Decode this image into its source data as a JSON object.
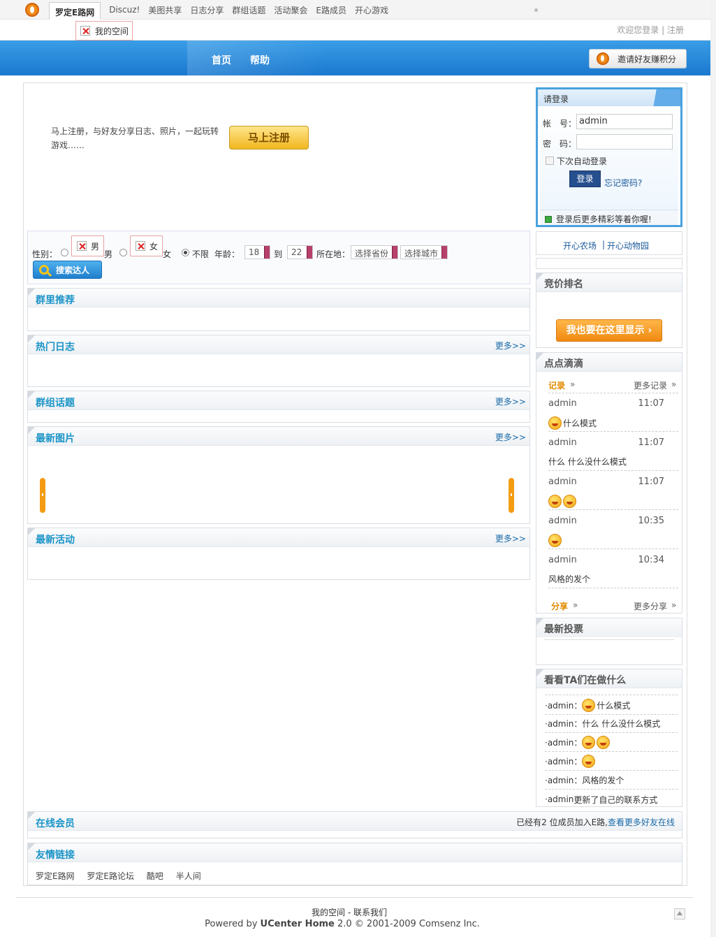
{
  "topbar": {
    "nav": [
      "罗定E路网",
      "Discuz!",
      "美图共享",
      "日志分享",
      "群组话题",
      "活动聚会",
      "E路成员",
      "开心游戏"
    ],
    "my_space": "我的空间",
    "welcome": "欢迎您登录",
    "register_link": "| 注册"
  },
  "header": {
    "home": "首页",
    "help": "帮助",
    "invite": "邀请好友赚积分"
  },
  "intro": {
    "text": "马上注册，与好友分享日志、照片，一起玩转游戏……",
    "register_button": "马上注册"
  },
  "search": {
    "gender_label": "性别：",
    "male_img": "男",
    "male": "男",
    "female_img": "女",
    "female": "女",
    "unlimited": "不限",
    "age_label": "年龄：",
    "age_from": "18",
    "to": "到",
    "age_to": "22",
    "location_label": "所在地：",
    "province": "选择省份",
    "city": "选择城市",
    "button": "搜索达人"
  },
  "panels": {
    "groups": "群里推荐",
    "blogs": "热门日志",
    "topics": "群组话题",
    "photos": "最新图片",
    "events": "最新活动",
    "more": "更多>>"
  },
  "login": {
    "title": "请登录",
    "account_label": "帐　号：",
    "account_value": "admin",
    "password_label": "密　码：",
    "remember": "下次自动登录",
    "button": "登录",
    "forgot": "忘记密码?",
    "footer": "登录后更多精彩等着你喔!"
  },
  "farm": {
    "farm": "开心农场",
    "sep": "|",
    "zoo": "开心动物园"
  },
  "bidding": {
    "title": "竞价排名",
    "button": "我也要在这里显示 ›"
  },
  "doings": {
    "title": "点点滴滴",
    "record_tab": "记录",
    "more_record": "更多记录",
    "share_tab": "分享",
    "more_share": "更多分享",
    "arrow": "»",
    "items": [
      {
        "user": "admin",
        "time": "11:07",
        "msg": "什么模式",
        "smiles": 1
      },
      {
        "user": "admin",
        "time": "11:07",
        "msg": "什么  什么没什么模式",
        "smiles": 0
      },
      {
        "user": "admin",
        "time": "11:07",
        "msg": "",
        "smiles": 2
      },
      {
        "user": "admin",
        "time": "10:35",
        "msg": "",
        "smiles": 1
      },
      {
        "user": "admin",
        "time": "10:34",
        "msg": "风格的发个",
        "smiles": 0
      }
    ]
  },
  "polls": {
    "title": "最新投票"
  },
  "whatdo": {
    "title": "看看TA们在做什么",
    "items": [
      {
        "text": "·admin：",
        "rest": "什么模式",
        "smiles": 1
      },
      {
        "text": "·admin：",
        "rest": "什么  什么没什么模式",
        "smiles": 0
      },
      {
        "text": "·admin：",
        "rest": "",
        "smiles": 2
      },
      {
        "text": "·admin：",
        "rest": "",
        "smiles": 1
      },
      {
        "text": "·admin：",
        "rest": "风格的发个",
        "smiles": 0
      },
      {
        "text": "·admin",
        "rest": " 更新了自己的联系方式",
        "smiles": 0
      }
    ]
  },
  "online": {
    "title": "在线会员",
    "text": "已经有2 位成员加入E路,",
    "link": "查看更多好友在线"
  },
  "friendlinks": {
    "title": "友情链接",
    "items": [
      "罗定E路网",
      "罗定E路论坛",
      "酷吧",
      "半人间"
    ]
  },
  "footer": {
    "links": "我的空间  - 联系我们",
    "powered": "Powered by ",
    "brand": "UCenter Home",
    "copyright": " 2.0 © 2001-2009 Comsenz Inc."
  },
  "colors": {
    "header_blue": "#1a78cf",
    "title_blue": "#1b94c8",
    "accent_orange": "#f08a10"
  }
}
